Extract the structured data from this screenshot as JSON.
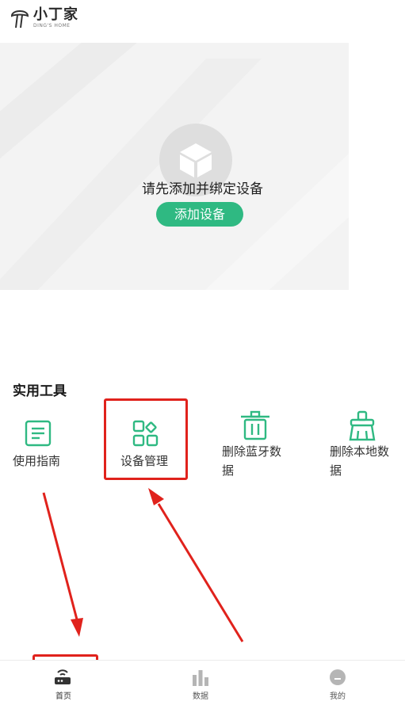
{
  "app": {
    "logo_title": "小丁家",
    "logo_subtitle": "DING'S HOME"
  },
  "empty_state": {
    "message": "请先添加并绑定设备",
    "add_button": "添加设备"
  },
  "tools": {
    "section_title": "实用工具",
    "items": [
      {
        "label": "使用指南",
        "icon": "guide-document-icon"
      },
      {
        "label": "设备管理",
        "icon": "device-grid-icon"
      },
      {
        "label_line1": "删除蓝牙数",
        "label_line2": "据",
        "icon": "trash-icon"
      },
      {
        "label_line1": "删除本地数",
        "label_line2": "据",
        "icon": "brush-clean-icon"
      }
    ]
  },
  "nav": {
    "items": [
      {
        "label": "首页",
        "icon": "router-icon",
        "active": true
      },
      {
        "label": "数据",
        "icon": "bar-chart-icon",
        "active": false
      },
      {
        "label": "我的",
        "icon": "user-icon",
        "active": false
      }
    ]
  },
  "colors": {
    "accent": "#2fb982",
    "annotation": "#e0221c",
    "banner_bg": "#f3f3f3"
  }
}
